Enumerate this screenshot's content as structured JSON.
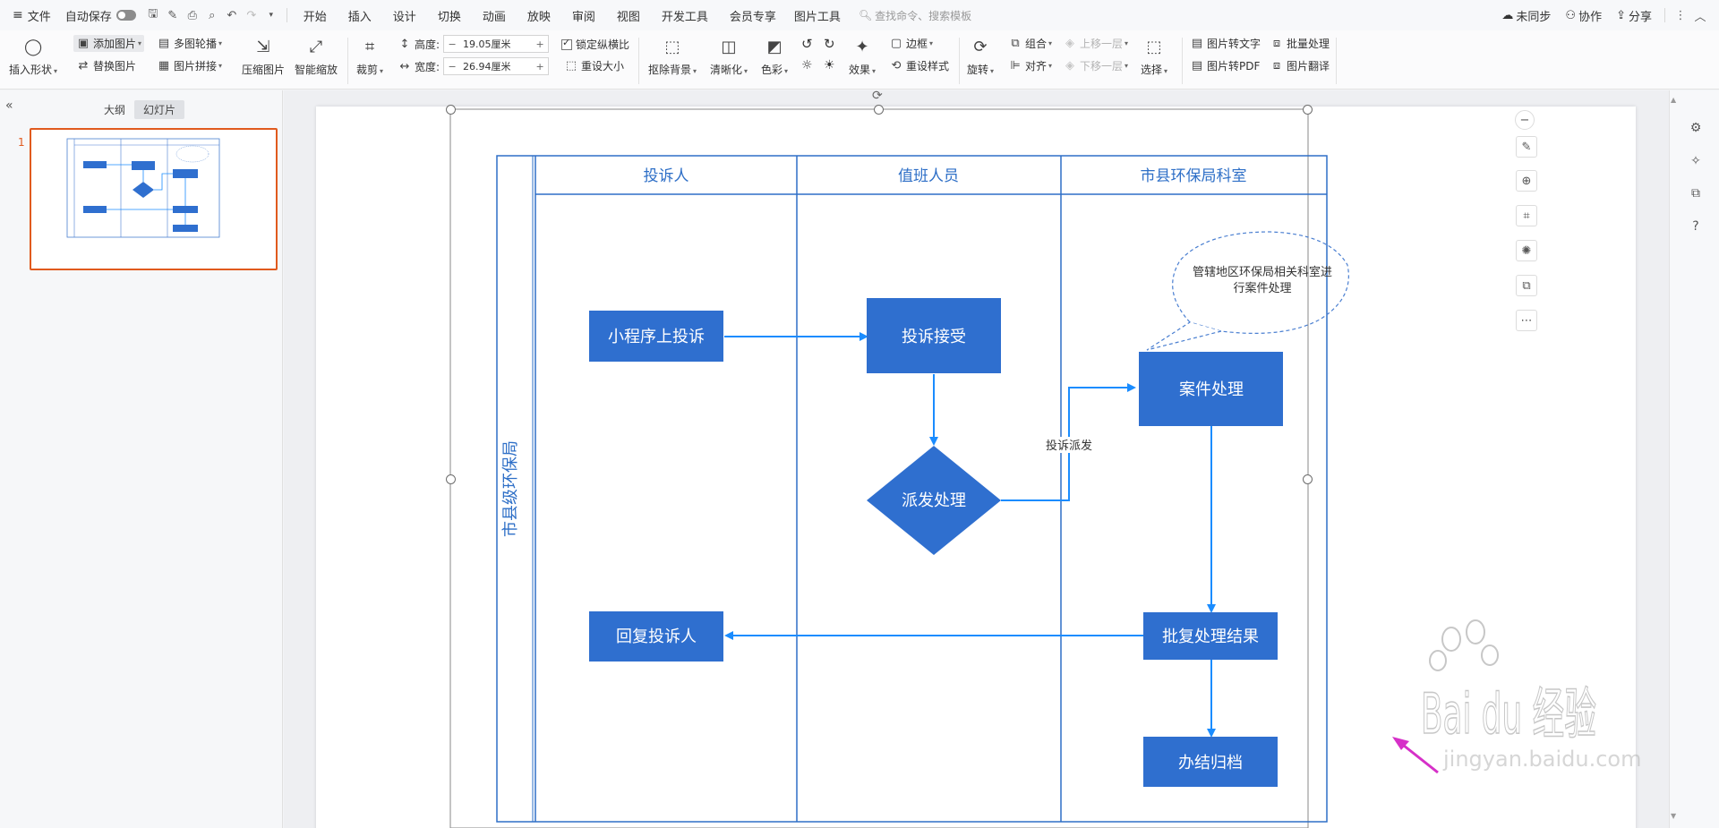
{
  "menubar": {
    "file": "文件",
    "autosave": "自动保存",
    "tabs": [
      "开始",
      "插入",
      "设计",
      "切换",
      "动画",
      "放映",
      "审阅",
      "视图",
      "开发工具",
      "会员专享"
    ],
    "active_tool_tab": "图片工具",
    "search_placeholder": "查找命令、搜索模板",
    "right": {
      "sync": "未同步",
      "collab": "协作",
      "share": "分享"
    }
  },
  "ribbon": {
    "insert_shape": "插入形状",
    "add_picture": "添加图片",
    "replace_picture": "替换图片",
    "multi_carousel": "多图轮播",
    "picture_collage": "图片拼接",
    "compress": "压缩图片",
    "smart_zoom": "智能缩放",
    "crop": "裁剪",
    "height_label": "高度:",
    "height_value": "19.05厘米",
    "width_label": "宽度:",
    "width_value": "26.94厘米",
    "lock_ratio": "锁定纵横比",
    "reset_size": "重设大小",
    "remove_bg": "抠除背景",
    "sharpen": "清晰化",
    "color": "色彩",
    "effects": "效果",
    "border": "边框",
    "reset_style": "重设样式",
    "rotate": "旋转",
    "group": "组合",
    "align": "对齐",
    "bring_forward": "上移一层",
    "send_backward": "下移一层",
    "select": "选择",
    "pic_to_text": "图片转文字",
    "batch": "批量处理",
    "pic_to_pdf": "图片转PDF",
    "pic_translate": "图片翻译"
  },
  "leftpane": {
    "outline_tab": "大纲",
    "slides_tab": "幻灯片",
    "slide_number": "1"
  },
  "flowchart": {
    "side_label": "市县级环保局",
    "lanes": [
      "投诉人",
      "值班人员",
      "市县环保局科室"
    ],
    "nodes": {
      "n1": "小程序上投诉",
      "n2": "投诉接受",
      "n3": "派发处理",
      "n4": "案件处理",
      "n5": "批复处理结果",
      "n6": "回复投诉人",
      "n7": "办结归档"
    },
    "edge_label": "投诉派发",
    "callout": [
      "管辖地区环保局相关科室进",
      "行案件处理"
    ]
  },
  "watermark": {
    "main": "Bai du 经验",
    "sub": "jingyan.baidu.com"
  },
  "colors": {
    "accent": "#f5622d",
    "flow_fill": "#2f6fcf",
    "flow_line": "#1a8cff",
    "lane_border": "#2e6fc7",
    "lane_text": "#2e6fc7",
    "thumb_border": "#e05a1e"
  },
  "icons": {
    "float_tools": [
      "zoom-out-icon",
      "edit-icon",
      "zoom-in-icon",
      "crop-icon",
      "idea-icon",
      "convert-icon",
      "more-icon"
    ],
    "side_panel": [
      "settings-icon",
      "pin-icon",
      "copy-icon",
      "help-icon"
    ]
  }
}
